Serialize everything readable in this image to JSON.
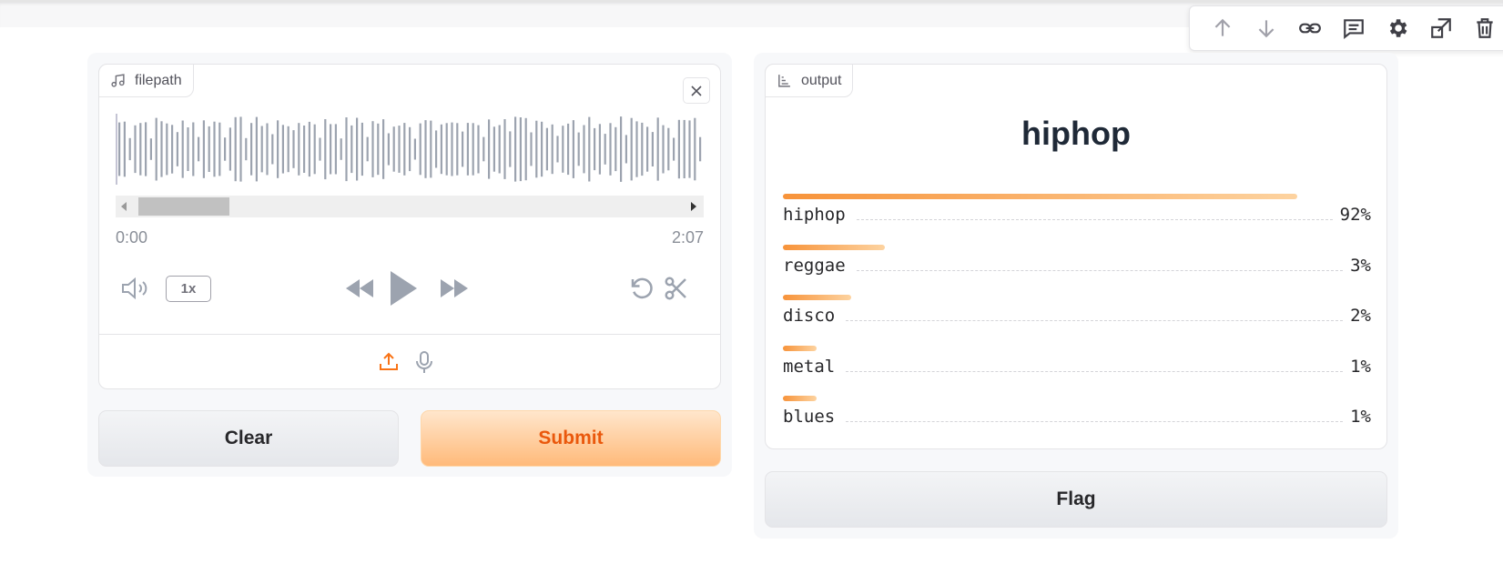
{
  "toolbar": {
    "items": [
      "arrow-up-icon",
      "arrow-down-icon",
      "link-icon",
      "comment-icon",
      "gear-icon",
      "share-icon",
      "trash-icon"
    ]
  },
  "input": {
    "label": "filepath",
    "time_start": "0:00",
    "time_end": "2:07",
    "speed": "1x"
  },
  "buttons": {
    "clear": "Clear",
    "submit": "Submit",
    "flag": "Flag"
  },
  "output": {
    "label": "output",
    "prediction": "hiphop",
    "confidences": [
      {
        "label": "hiphop",
        "value": "92%",
        "fraction": 0.92
      },
      {
        "label": "reggae",
        "value": "3%",
        "fraction": 0.03
      },
      {
        "label": "disco",
        "value": "2%",
        "fraction": 0.02
      },
      {
        "label": "metal",
        "value": "1%",
        "fraction": 0.01
      },
      {
        "label": "blues",
        "value": "1%",
        "fraction": 0.01
      }
    ]
  },
  "colors": {
    "accent": "#ea580c",
    "bar_start": "#f7933a",
    "bar_end": "#fdd3a0",
    "waveform": "#9ca3af"
  }
}
